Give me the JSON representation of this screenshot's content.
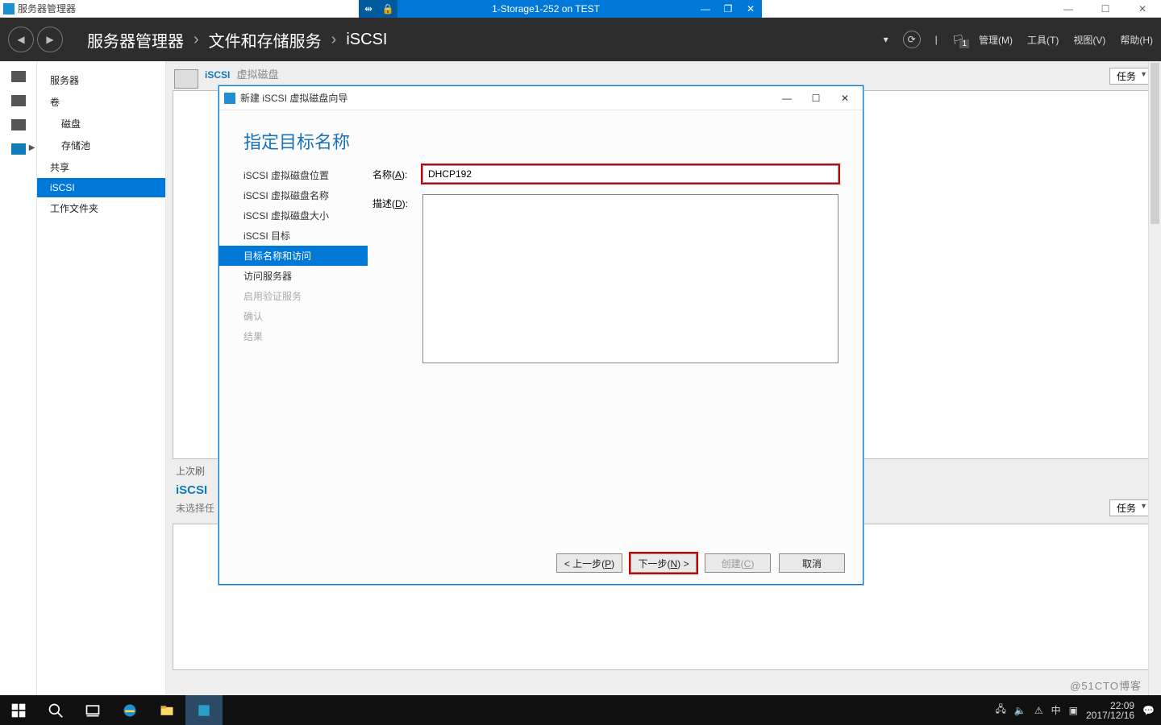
{
  "host": {
    "title": "服务器管理器"
  },
  "vmbar": {
    "title": "1-Storage1-252 on TEST"
  },
  "smheader": {
    "crumb1": "服务器管理器",
    "crumb2": "文件和存储服务",
    "crumb3": "iSCSI",
    "flag_badge": "1",
    "menu_manage": "管理(M)",
    "menu_tools": "工具(T)",
    "menu_view": "视图(V)",
    "menu_help": "帮助(H)"
  },
  "nav": {
    "servers": "服务器",
    "volumes": "卷",
    "disks": "磁盘",
    "pools": "存储池",
    "shares": "共享",
    "iscsi": "iSCSI",
    "workfolders": "工作文件夹"
  },
  "content": {
    "sec1_title": "iSCSI",
    "sec1_sub": "虚拟磁盘",
    "tasks": "任务",
    "last": "上次刷",
    "sec2_title": "iSCSI",
    "sec2_sub": "未选择任"
  },
  "wizard": {
    "title": "新建 iSCSI 虚拟磁盘向导",
    "heading": "指定目标名称",
    "steps": {
      "loc": "iSCSI 虚拟磁盘位置",
      "name": "iSCSI 虚拟磁盘名称",
      "size": "iSCSI 虚拟磁盘大小",
      "target": "iSCSI 目标",
      "tgtname": "目标名称和访问",
      "access": "访问服务器",
      "auth": "启用验证服务",
      "confirm": "确认",
      "result": "结果"
    },
    "labels": {
      "name_pre": "名称(",
      "name_u": "A",
      "name_post": "):",
      "desc_pre": "描述(",
      "desc_u": "D",
      "desc_post": "):"
    },
    "values": {
      "name": "DHCP192",
      "desc": ""
    },
    "buttons": {
      "prev_pre": "< 上一步(",
      "prev_u": "P",
      "prev_post": ")",
      "next_pre": "下一步(",
      "next_u": "N",
      "next_post": ") >",
      "create_pre": "创建(",
      "create_u": "C",
      "create_post": ")",
      "cancel": "取消"
    }
  },
  "tray": {
    "ime": "中",
    "time": "22:09",
    "date": "2017/12/16"
  },
  "watermark": "@51CTO博客"
}
